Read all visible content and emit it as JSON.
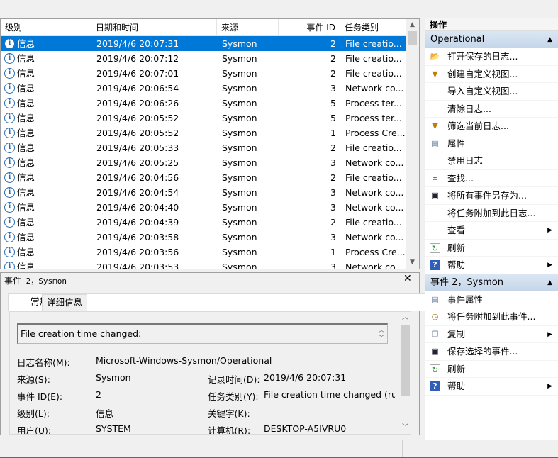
{
  "list": {
    "columns": [
      "级别",
      "日期和时间",
      "来源",
      "事件 ID",
      "任务类别"
    ],
    "rows": [
      {
        "level": "信息",
        "datetime": "2019/4/6 20:07:31",
        "source": "Sysmon",
        "event_id": "2",
        "task": "File creatio...",
        "selected": true
      },
      {
        "level": "信息",
        "datetime": "2019/4/6 20:07:12",
        "source": "Sysmon",
        "event_id": "2",
        "task": "File creatio..."
      },
      {
        "level": "信息",
        "datetime": "2019/4/6 20:07:01",
        "source": "Sysmon",
        "event_id": "2",
        "task": "File creatio..."
      },
      {
        "level": "信息",
        "datetime": "2019/4/6 20:06:54",
        "source": "Sysmon",
        "event_id": "3",
        "task": "Network co..."
      },
      {
        "level": "信息",
        "datetime": "2019/4/6 20:06:26",
        "source": "Sysmon",
        "event_id": "5",
        "task": "Process ter..."
      },
      {
        "level": "信息",
        "datetime": "2019/4/6 20:05:52",
        "source": "Sysmon",
        "event_id": "5",
        "task": "Process ter..."
      },
      {
        "level": "信息",
        "datetime": "2019/4/6 20:05:52",
        "source": "Sysmon",
        "event_id": "1",
        "task": "Process Cre..."
      },
      {
        "level": "信息",
        "datetime": "2019/4/6 20:05:33",
        "source": "Sysmon",
        "event_id": "2",
        "task": "File creatio..."
      },
      {
        "level": "信息",
        "datetime": "2019/4/6 20:05:25",
        "source": "Sysmon",
        "event_id": "3",
        "task": "Network co..."
      },
      {
        "level": "信息",
        "datetime": "2019/4/6 20:04:56",
        "source": "Sysmon",
        "event_id": "2",
        "task": "File creatio..."
      },
      {
        "level": "信息",
        "datetime": "2019/4/6 20:04:54",
        "source": "Sysmon",
        "event_id": "3",
        "task": "Network co..."
      },
      {
        "level": "信息",
        "datetime": "2019/4/6 20:04:40",
        "source": "Sysmon",
        "event_id": "3",
        "task": "Network co..."
      },
      {
        "level": "信息",
        "datetime": "2019/4/6 20:04:39",
        "source": "Sysmon",
        "event_id": "2",
        "task": "File creatio..."
      },
      {
        "level": "信息",
        "datetime": "2019/4/6 20:03:58",
        "source": "Sysmon",
        "event_id": "3",
        "task": "Network co..."
      },
      {
        "level": "信息",
        "datetime": "2019/4/6 20:03:56",
        "source": "Sysmon",
        "event_id": "1",
        "task": "Process Cre..."
      },
      {
        "level": "信息",
        "datetime": "2019/4/6 20:03:53",
        "source": "Sysmon",
        "event_id": "3",
        "task": "Network co..."
      }
    ]
  },
  "detail": {
    "title_prefix": "事件",
    "title_rest": " 2，Sysmon",
    "close": "✕",
    "tabs": [
      "常规",
      "详细信息"
    ],
    "message": "File creation time changed:",
    "fields": {
      "log_name_label": "日志名称(M):",
      "log_name": "Microsoft-Windows-Sysmon/Operational",
      "source_label": "来源(S):",
      "source": "Sysmon",
      "logged_label": "记录时间(D):",
      "logged": "2019/4/6 20:07:31",
      "event_id_label": "事件 ID(E):",
      "event_id": "2",
      "task_label": "任务类别(Y):",
      "task": "File creation time changed (rule",
      "level_label": "级别(L):",
      "level": "信息",
      "keywords_label": "关键字(K):",
      "user_label": "用户(U):",
      "user": "SYSTEM",
      "computer_label": "计算机(R):",
      "computer": "DESKTOP-A5IVRU0"
    }
  },
  "actions": {
    "header": "操作",
    "sections": [
      {
        "title": "Operational",
        "items": [
          {
            "label": "打开保存的日志...",
            "icon": "folder-icon"
          },
          {
            "label": "创建自定义视图...",
            "icon": "filter-icon"
          },
          {
            "label": "导入自定义视图...",
            "icon": ""
          },
          {
            "label": "清除日志...",
            "icon": ""
          },
          {
            "label": "筛选当前日志...",
            "icon": "filter-icon"
          },
          {
            "label": "属性",
            "icon": "properties-icon"
          },
          {
            "label": "禁用日志",
            "icon": ""
          },
          {
            "label": "查找...",
            "icon": "binoculars-icon"
          },
          {
            "label": "将所有事件另存为...",
            "icon": "save-icon"
          },
          {
            "label": "将任务附加到此日志...",
            "icon": ""
          },
          {
            "label": "查看",
            "icon": "",
            "submenu": true
          },
          {
            "label": "刷新",
            "icon": "refresh-icon"
          },
          {
            "label": "帮助",
            "icon": "help-icon",
            "submenu": true
          }
        ]
      },
      {
        "title": "事件 2，Sysmon",
        "items": [
          {
            "label": "事件属性",
            "icon": "properties-icon"
          },
          {
            "label": "将任务附加到此事件...",
            "icon": "task-icon"
          },
          {
            "label": "复制",
            "icon": "copy-icon",
            "submenu": true
          },
          {
            "label": "保存选择的事件...",
            "icon": "save-icon"
          },
          {
            "label": "刷新",
            "icon": "refresh-icon"
          },
          {
            "label": "帮助",
            "icon": "help-icon",
            "submenu": true
          }
        ]
      }
    ]
  },
  "colors": {
    "selection": "#0078d7",
    "section_header": "#c5d6ea",
    "accent_line": "#1a79c4"
  }
}
